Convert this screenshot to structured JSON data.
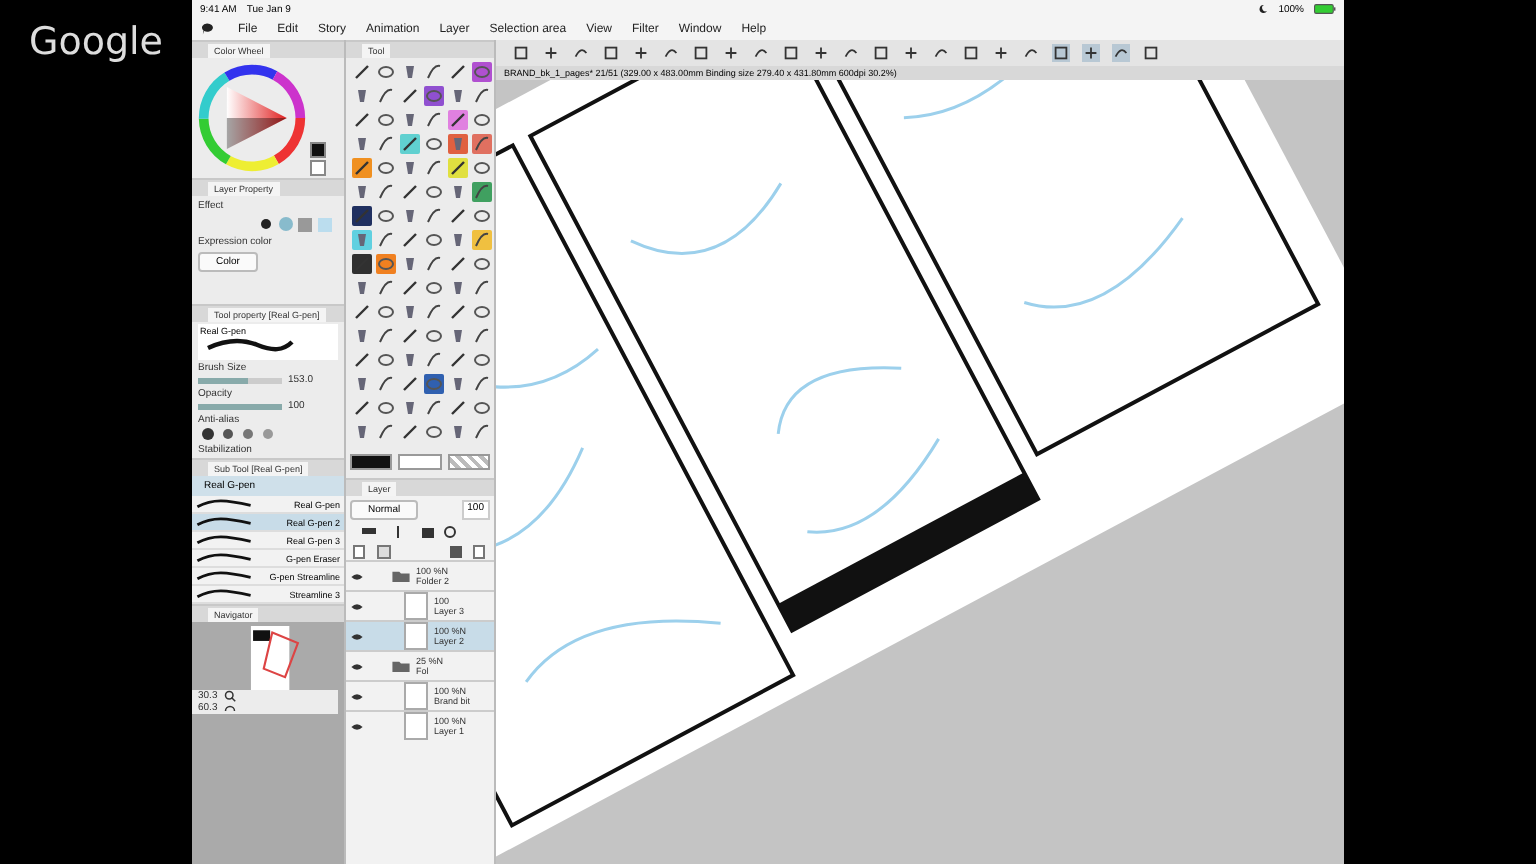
{
  "video_overlay": {
    "logo_text": "Google"
  },
  "status_bar": {
    "time": "9:41 AM",
    "date": "Tue Jan 9",
    "battery": "100%"
  },
  "menu_bar": {
    "items": [
      "File",
      "Edit",
      "Story",
      "Animation",
      "Layer",
      "Selection area",
      "View",
      "Filter",
      "Window",
      "Help"
    ]
  },
  "color_wheel": {
    "title": "Color Wheel"
  },
  "layer_property": {
    "title": "Layer Property",
    "effect_label": "Effect",
    "expression_color_label": "Expression color",
    "expression_color": "Color"
  },
  "tool_panel": {
    "title": "Tool"
  },
  "tool_property": {
    "title": "Tool property [Real G-pen]",
    "brush_name": "Real G-pen",
    "settings": [
      {
        "kind": "slider",
        "label": "Brush Size",
        "value": "153.0",
        "level": 0.6
      },
      {
        "kind": "slider",
        "label": "Opacity",
        "value": "100",
        "level": 1.0
      },
      {
        "kind": "choice",
        "label": "Anti-alias"
      },
      {
        "kind": "label",
        "label": "Stabilization"
      }
    ]
  },
  "sub_tool": {
    "title": "Sub Tool [Real G-pen]",
    "group": "Real G-pen",
    "items": [
      {
        "name": "Real G-pen",
        "selected": false
      },
      {
        "name": "Real G-pen 2",
        "selected": true
      },
      {
        "name": "Real G-pen 3",
        "selected": false
      },
      {
        "name": "G-pen Eraser",
        "selected": false
      },
      {
        "name": "G-pen Streamline",
        "selected": false
      },
      {
        "name": "Streamline 3",
        "selected": false
      }
    ]
  },
  "navigator": {
    "title": "Navigator",
    "zoom": "30.3",
    "rotation": "60.3"
  },
  "layer_panel": {
    "title": "Layer",
    "blend_mode": "Normal",
    "opacity": "100",
    "layers": [
      {
        "kind": "folder",
        "name": "Folder 2",
        "opacity": "100 %",
        "blend": "N",
        "selected": false,
        "children": [
          {
            "kind": "layer",
            "name": "Layer 3",
            "opacity": "100",
            "selected": false
          },
          {
            "kind": "layer",
            "name": "Layer 2",
            "opacity": "100 %",
            "blend": "N",
            "selected": true
          }
        ]
      },
      {
        "kind": "folder",
        "name": "Fol",
        "opacity": "25 %",
        "blend": "N",
        "selected": false,
        "children": [
          {
            "kind": "layer",
            "name": "Brand bit",
            "opacity": "100 %",
            "blend": "N",
            "selected": false
          },
          {
            "kind": "layer",
            "name": "Layer 1",
            "opacity": "100 %",
            "blend": "N",
            "selected": false
          }
        ]
      }
    ]
  },
  "canvas": {
    "document_title": "BRAND_bk_1_pages* 21/51 (329.00 x 483.00mm Binding size 279.40 x 431.80mm 600dpi 30.2%)"
  }
}
